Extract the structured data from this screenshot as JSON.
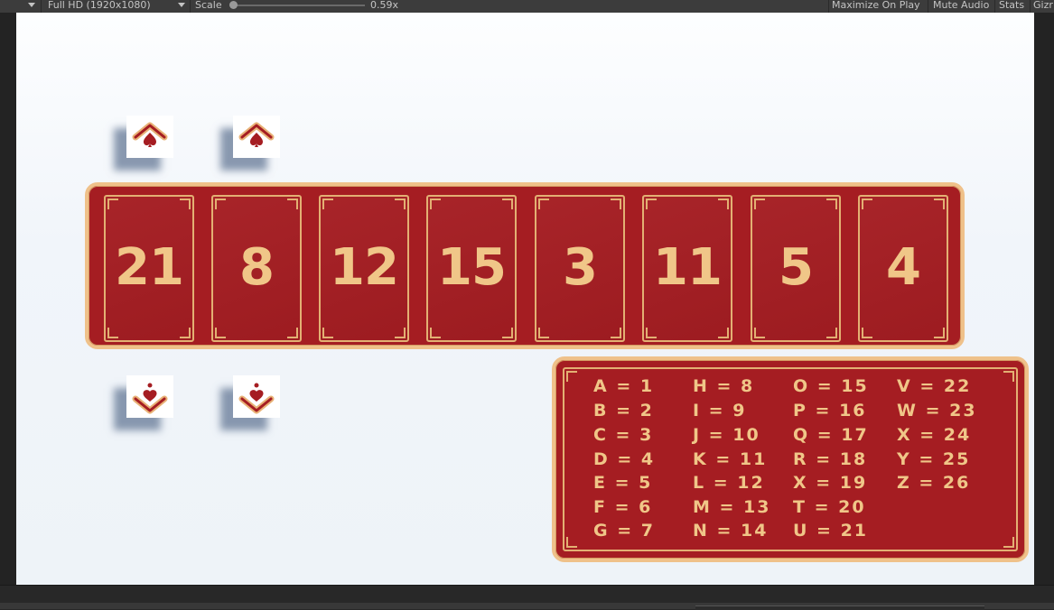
{
  "toolbar": {
    "resolution": "Full HD (1920x1080)",
    "scale_label": "Scale",
    "scale_value": "0.59x",
    "scale_fraction": 0.0,
    "maximize_on_play": "Maximize On Play",
    "mute_audio": "Mute Audio",
    "stats": "Stats",
    "gizmos": "Gizr"
  },
  "cards": [
    "21",
    "8",
    "12",
    "15",
    "3",
    "11",
    "5",
    "4"
  ],
  "legend": {
    "columns": [
      [
        "A = 1",
        "B = 2",
        "C = 3",
        "D = 4",
        "E = 5",
        "F = 6",
        "G = 7"
      ],
      [
        "H = 8",
        "I = 9",
        "J = 10",
        "K = 11",
        "L = 12",
        "M = 13",
        "N = 14"
      ],
      [
        "O = 15",
        "P = 16",
        "Q = 17",
        "R = 18",
        "X = 19",
        "T = 20",
        "U = 21"
      ],
      [
        "V = 22",
        "W = 23",
        "X = 24",
        "Y = 25",
        "Z = 26"
      ]
    ]
  },
  "colors": {
    "panel_red": "#a51d22",
    "gold": "#f0c688",
    "arrow_red": "#a51d22",
    "arrow_gold": "#e8b277"
  }
}
